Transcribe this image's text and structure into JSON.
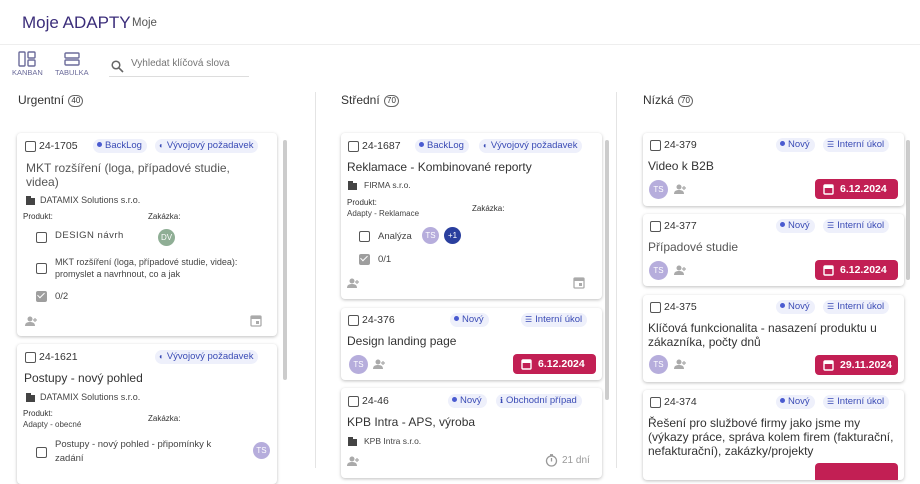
{
  "app": {
    "title": "Moje ADAPTY",
    "subtitle": "Moje"
  },
  "toolbar": {
    "kanban": "KANBAN",
    "table": "TABULKA",
    "search_placeholder": "Vyhledat klíčová slova"
  },
  "columns": [
    {
      "name": "Urgentní",
      "count": "40"
    },
    {
      "name": "Střední",
      "count": "70"
    },
    {
      "name": "Nízká",
      "count": "70"
    }
  ],
  "colors": {
    "accent": "#3b2d7a",
    "date_badge": "#c21f54",
    "tag_bg": "#eef0fb",
    "avatar": "#b6addc"
  },
  "cards": {
    "u1": {
      "id": "24-1705",
      "tag1": "BackLog",
      "tag2": "Vývojový požadavek",
      "title": "MKT rozšíření (loga, případové studie, videa)",
      "company": "DATAMIX Solutions s.r.o.",
      "produkt_label": "Produkt:",
      "zakazka_label": "Zakázka:",
      "sub1": "DESIGN návrh",
      "sub1_avatar": "DV",
      "sub2": "MKT rozšíření (loga, případové studie, videa): promyslet a navrhnout, co a jak",
      "progress": "0/2"
    },
    "u2": {
      "id": "24-1621",
      "tag1": "Vývojový požadavek",
      "title": "Postupy - nový pohled",
      "company": "DATAMIX Solutions s.r.o.",
      "produkt_label": "Produkt:",
      "produkt_value": "Adapty - obecné",
      "zakazka_label": "Zakázka:",
      "sub1": "Postupy - nový pohled - připomínky k zadání",
      "sub1_avatar": "TS"
    },
    "s1": {
      "id": "24-1687",
      "tag1": "BackLog",
      "tag2": "Vývojový požadavek",
      "title": "Reklamace - Kombinované reporty",
      "company": "FIRMA s.r.o.",
      "produkt_label": "Produkt:",
      "produkt_value": "Adapty - Reklamace",
      "zakazka_label": "Zakázka:",
      "sub1": "Analýza",
      "sub1_avatar": "TS",
      "sub1_more": "+1",
      "progress": "0/1"
    },
    "s2": {
      "id": "24-376",
      "tag1": "Nový",
      "tag2": "Interní úkol",
      "title": "Design landing page",
      "avatar": "TS",
      "date": "6.12.2024"
    },
    "s3": {
      "id": "24-46",
      "tag1": "Nový",
      "tag2": "Obchodní případ",
      "title": "KPB Intra - APS, výroba",
      "company": "KPB Intra s.r.o.",
      "timer": "21 dní"
    },
    "n1": {
      "id": "24-379",
      "tag1": "Nový",
      "tag2": "Interní úkol",
      "title": "Video k B2B",
      "avatar": "TS",
      "date": "6.12.2024"
    },
    "n2": {
      "id": "24-377",
      "tag1": "Nový",
      "tag2": "Interní úkol",
      "title": "Případové studie",
      "avatar": "TS",
      "date": "6.12.2024"
    },
    "n3": {
      "id": "24-375",
      "tag1": "Nový",
      "tag2": "Interní úkol",
      "title": "Klíčová funkcionalita - nasazení produktu u zákazníka, počty dnů",
      "avatar": "TS",
      "date": "29.11.2024"
    },
    "n4": {
      "id": "24-374",
      "tag1": "Nový",
      "tag2": "Interní úkol",
      "title": "Řešení pro službové firmy jako jsme my (výkazy práce, správa kolem firem (fakturační, nefakturační), zakázky/projekty"
    }
  }
}
